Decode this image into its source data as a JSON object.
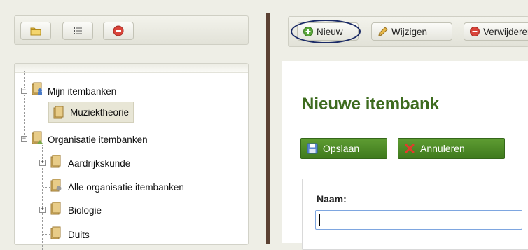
{
  "left_toolbar": {
    "buttons": [
      {
        "name": "folder-icon"
      },
      {
        "name": "list-icon"
      },
      {
        "name": "remove-icon"
      }
    ]
  },
  "tree": {
    "nodes": [
      {
        "label": "Mijn itembanken",
        "level": 0,
        "expanded": true
      },
      {
        "label": "Muziektheorie",
        "level": 1,
        "selected": true
      },
      {
        "label": "Organisatie itembanken",
        "level": 0,
        "expanded": true
      },
      {
        "label": "Aardrijkskunde",
        "level": 1,
        "expandable": true
      },
      {
        "label": "Alle organisatie itembanken",
        "level": 1
      },
      {
        "label": "Biologie",
        "level": 1,
        "expandable": true
      },
      {
        "label": "Duits",
        "level": 1
      }
    ]
  },
  "right_toolbar": {
    "new_label": "Nieuw",
    "edit_label": "Wijzigen",
    "delete_label": "Verwijderen"
  },
  "content": {
    "title": "Nieuwe itembank",
    "save_label": "Opslaan",
    "cancel_label": "Annuleren",
    "name_label": "Naam:",
    "name_value": ""
  },
  "colors": {
    "title_green": "#3d6b1e",
    "button_green": "#4f8d28",
    "divider_brown": "#5b4133",
    "highlight_ellipse": "#1a2a66"
  }
}
